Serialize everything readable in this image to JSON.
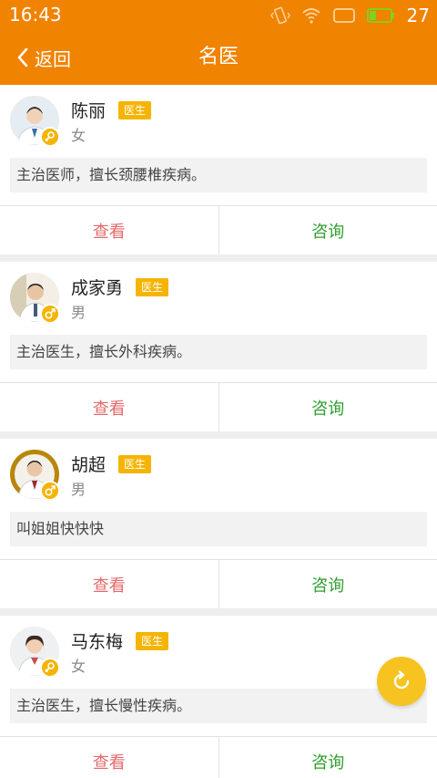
{
  "status_bar": {
    "time": "16:43",
    "battery": "27"
  },
  "nav": {
    "back_label": "返回",
    "title": "名医"
  },
  "doctors": [
    {
      "name": "陈丽",
      "badge": "医生",
      "gender": "女",
      "gender_icon": "female-icon",
      "description": "主治医师，擅长颈腰椎疾病。",
      "view_label": "查看",
      "consult_label": "咨询"
    },
    {
      "name": "成家勇",
      "badge": "医生",
      "gender": "男",
      "gender_icon": "male-icon",
      "description": "主治医生，擅长外科疾病。",
      "view_label": "查看",
      "consult_label": "咨询"
    },
    {
      "name": "胡超",
      "badge": "医生",
      "gender": "男",
      "gender_icon": "male-icon",
      "description": "叫姐姐快快快",
      "view_label": "查看",
      "consult_label": "咨询"
    },
    {
      "name": "马东梅",
      "badge": "医生",
      "gender": "女",
      "gender_icon": "female-icon",
      "description": "主治医生，擅长慢性疾病。",
      "view_label": "查看",
      "consult_label": "咨询"
    }
  ],
  "colors": {
    "header": "#f08300",
    "badge": "#f5b400",
    "view": "#e46a6a",
    "consult": "#2e9e2e",
    "fab": "#f7c320"
  },
  "fab": {
    "icon": "refresh-icon"
  }
}
